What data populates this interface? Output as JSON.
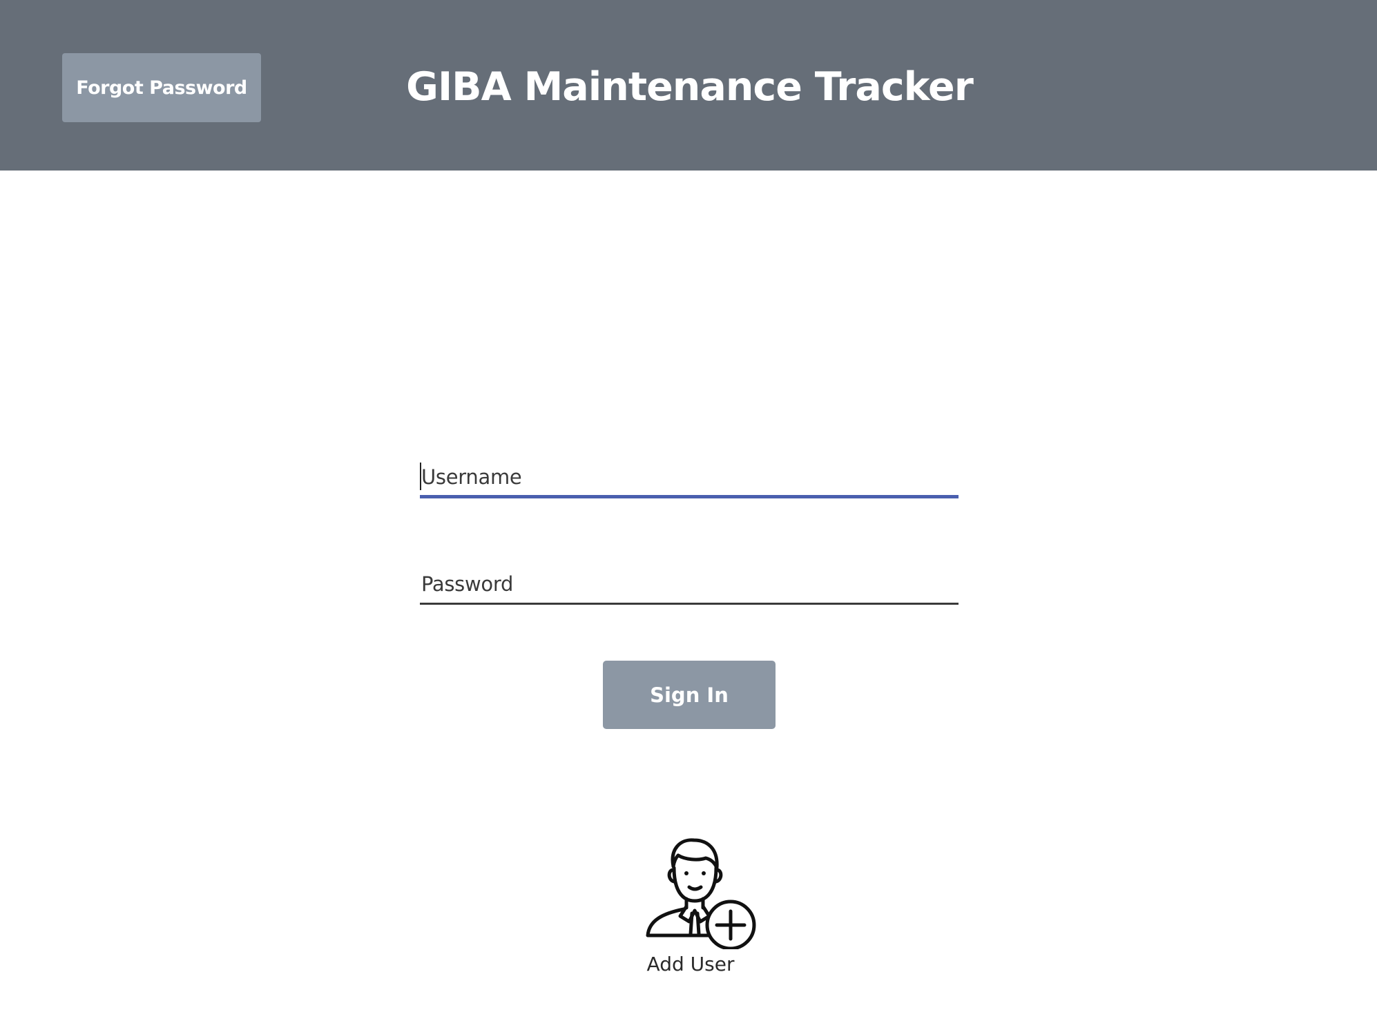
{
  "header": {
    "forgot_password_label": "Forgot Password",
    "title": "GIBA Maintenance Tracker",
    "background_color": "#666e78"
  },
  "login": {
    "username_placeholder": "Username",
    "password_placeholder": "Password",
    "sign_in_label": "Sign In",
    "focus_color": "#4a5fae",
    "button_color": "#8c97a4"
  },
  "add_user": {
    "label": "Add User",
    "icon": "add-user-icon"
  }
}
